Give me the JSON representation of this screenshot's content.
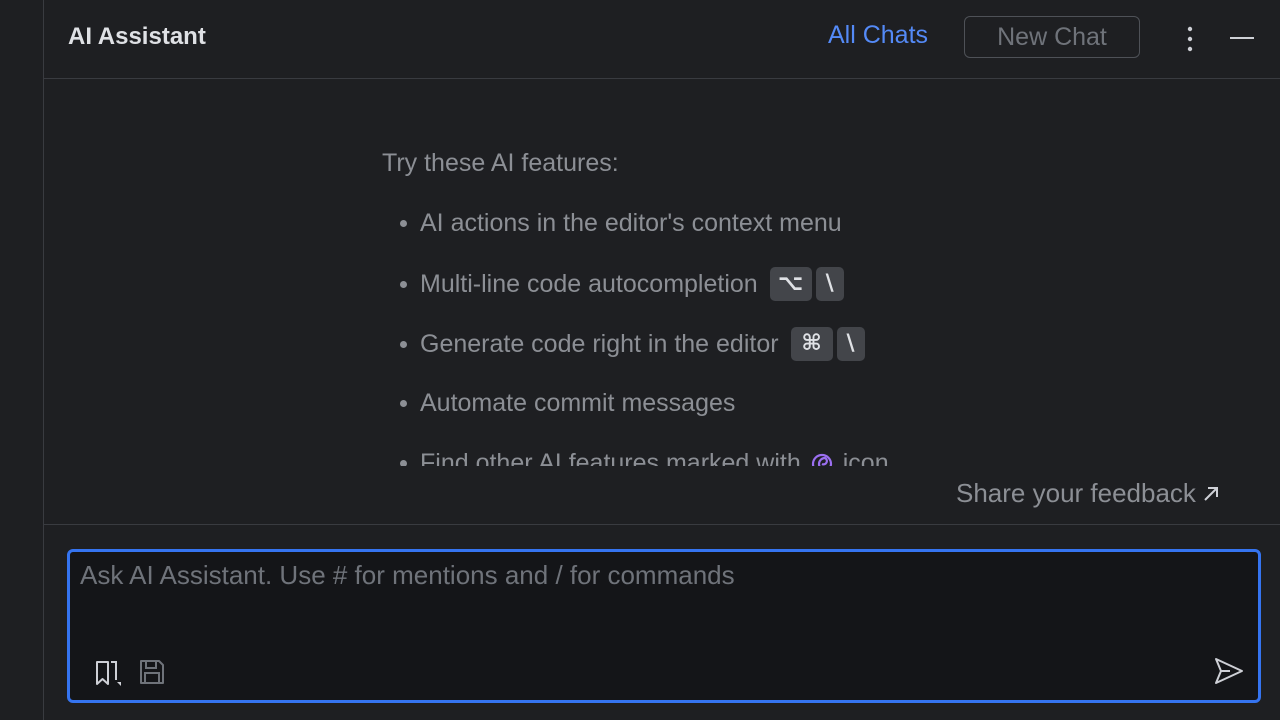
{
  "header": {
    "title": "AI Assistant",
    "all_chats_label": "All Chats",
    "new_chat_label": "New Chat",
    "more_icon": "vertical-ellipsis-icon",
    "minimize_icon": "minimize-icon"
  },
  "hints": {
    "heading": "Try these AI features:",
    "items": [
      {
        "text": "AI actions in the editor's context menu"
      },
      {
        "text": "Multi-line code autocompletion",
        "keys": [
          "⌥",
          "\\"
        ]
      },
      {
        "text": "Generate code right in the editor",
        "keys": [
          "⌘",
          "\\"
        ]
      },
      {
        "text": "Automate commit messages"
      },
      {
        "text": "Find other AI features marked with",
        "icon": "ai-spiral-icon",
        "suffix": "icon"
      }
    ]
  },
  "feedback": {
    "label": "Share your feedback",
    "icon": "external-arrow-icon"
  },
  "input": {
    "value": "",
    "placeholder": "Ask AI Assistant. Use # for mentions and / for commands",
    "attach_icon": "add-context-icon",
    "save_icon": "save-prompt-icon",
    "send_icon": "send-icon"
  },
  "colors": {
    "accent": "#3574f0",
    "link": "#548af7",
    "ai_icon": "#9b6ff0"
  }
}
